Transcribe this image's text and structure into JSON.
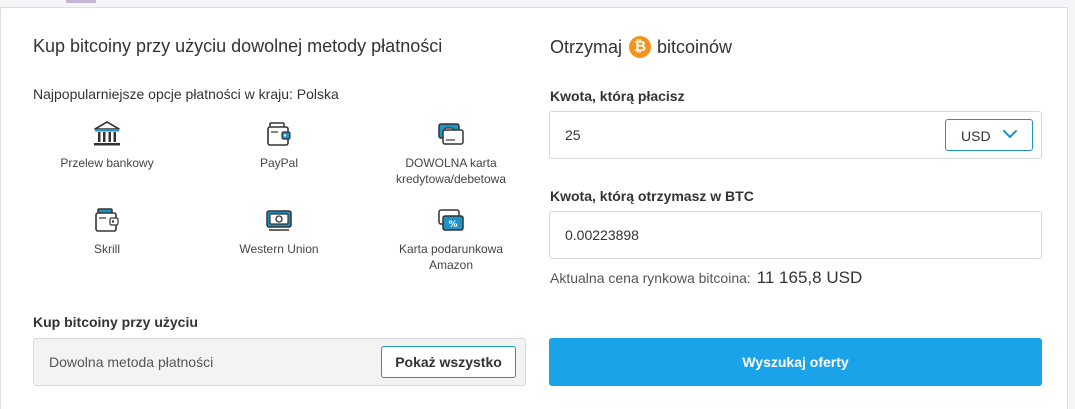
{
  "left": {
    "title": "Kup bitcoiny przy użyciu dowolnej metody płatności",
    "subtitle": "Najpopularniejsze opcje płatności w kraju: Polska",
    "methods": [
      {
        "label": "Przelew bankowy",
        "icon": "bank-icon"
      },
      {
        "label": "PayPal",
        "icon": "wallet-icon"
      },
      {
        "label": "DOWOLNA karta kredytowa/debetowa",
        "icon": "credit-card-icon"
      },
      {
        "label": "Skrill",
        "icon": "wallet-icon"
      },
      {
        "label": "Western Union",
        "icon": "cash-icon"
      },
      {
        "label": "Karta podarunkowa Amazon",
        "icon": "gift-card-icon"
      }
    ],
    "buy_with_label": "Kup bitcoiny przy użyciu",
    "any_method_text": "Dowolna metoda płatności",
    "show_all_label": "Pokaż wszystko"
  },
  "right": {
    "title_prefix": "Otrzymaj",
    "coin_symbol": "₿",
    "title_suffix": "bitcoinów",
    "pay_label": "Kwota, którą płacisz",
    "pay_value": "25",
    "currency": "USD",
    "receive_label": "Kwota, którą otrzymasz w BTC",
    "receive_value": "0.00223898",
    "price_label": "Aktualna cena rynkowa bitcoina:",
    "price_value": "11 165,8 USD",
    "search_label": "Wyszukaj oferty"
  },
  "colors": {
    "accent": "#1e93c7",
    "button": "#1aa3e8",
    "bitcoin": "#f7931a"
  }
}
